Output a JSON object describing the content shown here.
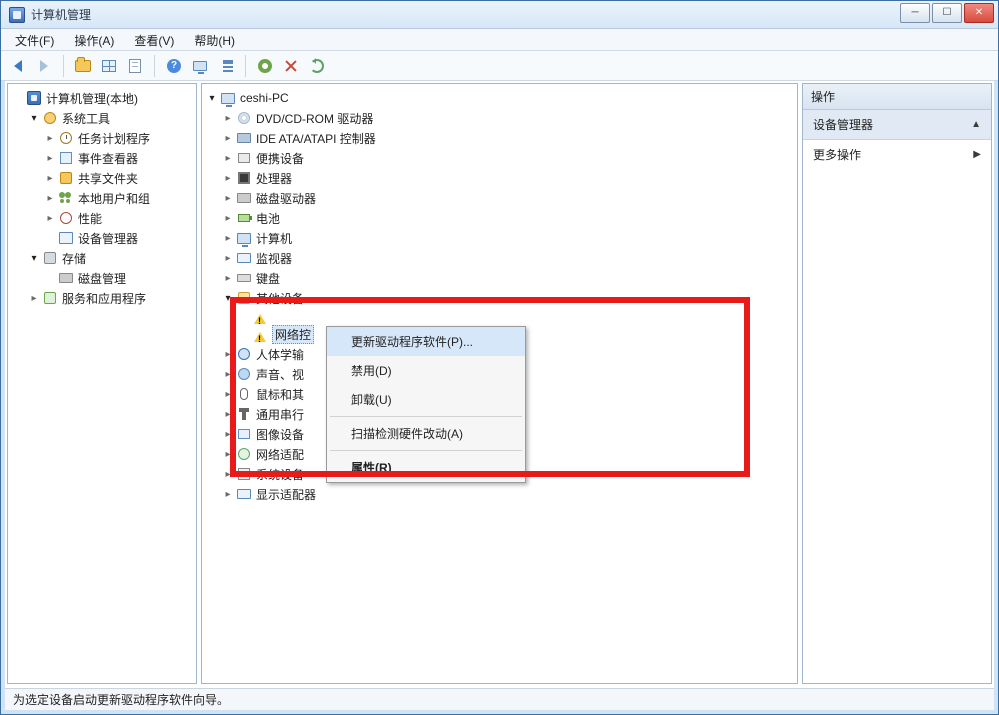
{
  "window": {
    "title": "计算机管理"
  },
  "menus": {
    "file": "文件(F)",
    "action": "操作(A)",
    "view": "查看(V)",
    "help": "帮助(H)"
  },
  "left_tree": {
    "root": "计算机管理(本地)",
    "system_tools": "系统工具",
    "task_scheduler": "任务计划程序",
    "event_viewer": "事件查看器",
    "shared_folders": "共享文件夹",
    "local_users": "本地用户和组",
    "performance": "性能",
    "device_manager": "设备管理器",
    "storage": "存储",
    "disk_mgmt": "磁盘管理",
    "services_apps": "服务和应用程序"
  },
  "center_tree": {
    "root": "ceshi-PC",
    "dvd": "DVD/CD-ROM 驱动器",
    "ide": "IDE ATA/ATAPI 控制器",
    "portable": "便携设备",
    "cpu": "处理器",
    "disk": "磁盘驱动器",
    "battery": "电池",
    "computer": "计算机",
    "monitor": "监视器",
    "keyboard": "键盘",
    "other": "其他设备",
    "net_ctrl_prefix": "网络控",
    "hid": "人体学输",
    "audio": "声音、视",
    "mouse": "鼠标和其",
    "usb": "通用串行",
    "imaging": "图像设备",
    "netadapter": "网络适配",
    "system": "系统设备",
    "display": "显示适配器"
  },
  "context_menu": {
    "update": "更新驱动程序软件(P)...",
    "disable": "禁用(D)",
    "uninstall": "卸载(U)",
    "scan": "扫描检测硬件改动(A)",
    "properties": "属性(R)"
  },
  "actions_pane": {
    "header": "操作",
    "section": "设备管理器",
    "more": "更多操作"
  },
  "status": "为选定设备启动更新驱动程序软件向导。"
}
